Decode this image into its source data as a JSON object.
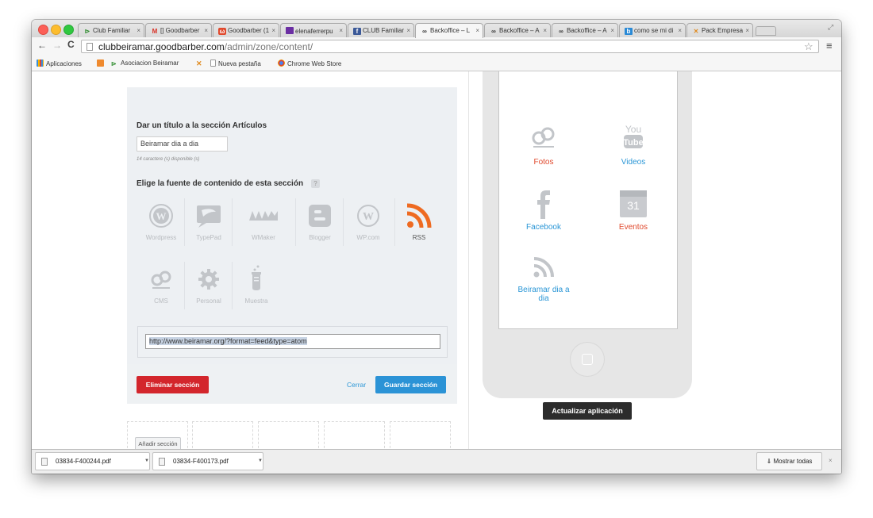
{
  "browser": {
    "tabs": [
      {
        "label": "Club Familiar",
        "icon": "club-icon"
      },
      {
        "label": "[] Goodbarber",
        "icon": "gmail-icon"
      },
      {
        "label": "Goodbarber (1",
        "icon": "goodbarber-icon"
      },
      {
        "label": "elenaferrerpu",
        "icon": "yahoo-mail-icon"
      },
      {
        "label": "CLUB Familiar",
        "icon": "facebook-icon"
      },
      {
        "label": "Backoffice – L",
        "icon": "goodbarber-logo-icon"
      },
      {
        "label": "Backoffice – A",
        "icon": "goodbarber-logo-icon"
      },
      {
        "label": "Backoffice – A",
        "icon": "goodbarber-logo-icon"
      },
      {
        "label": "como se mi di",
        "icon": "bing-icon"
      },
      {
        "label": "Pack Empresa",
        "icon": "pack-icon"
      }
    ],
    "tab_close_glyph": "×",
    "url_host": "clubbeiramar.goodbarber.com",
    "url_path": "/admin/zone/content/",
    "bookmarks": [
      {
        "label": "Aplicaciones",
        "icon": "apps-grid-icon"
      },
      {
        "label": "",
        "icon": "bookmark-icon"
      },
      {
        "label": "Asociacion Beiramar",
        "icon": "beiramar-icon"
      },
      {
        "label": "",
        "icon": "joomla-icon"
      },
      {
        "label": "Nueva pestaña",
        "icon": "page-icon"
      },
      {
        "label": "Chrome Web Store",
        "icon": "chrome-store-icon"
      }
    ]
  },
  "editor": {
    "title_label": "Dar un título a la sección Artículos",
    "title_value": "Beiramar dia a dia",
    "title_hint": "14 caractere (s) disponible (s)",
    "source_label": "Elige la fuente de contenido de esta sección",
    "help_glyph": "?",
    "sources": [
      {
        "label": "Wordpress",
        "icon": "wordpress-icon",
        "selected": false
      },
      {
        "label": "TypePad",
        "icon": "typepad-icon",
        "selected": false
      },
      {
        "label": "WMaker",
        "icon": "wmaker-icon",
        "selected": false
      },
      {
        "label": "Blogger",
        "icon": "blogger-icon",
        "selected": false
      },
      {
        "label": "WP.com",
        "icon": "wpcom-icon",
        "selected": false
      },
      {
        "label": "RSS",
        "icon": "rss-icon",
        "selected": true
      },
      {
        "label": "CMS",
        "icon": "cms-icon",
        "selected": false
      },
      {
        "label": "Personal",
        "icon": "gear-icon",
        "selected": false
      },
      {
        "label": "Muestra",
        "icon": "test-tube-icon",
        "selected": false
      }
    ],
    "feed_url": "http://www.beiramar.org/?format=feed&type=atom",
    "delete_label": "Eliminar sección",
    "close_label": "Cerrar",
    "save_label": "Guardar sección",
    "add_section_label": "Añadir sección"
  },
  "preview": {
    "apps": [
      {
        "label": "Fotos",
        "icon": "fotos-icon",
        "color": "#e0492d"
      },
      {
        "label": "Videos",
        "icon": "youtube-icon",
        "color": "#2a96d6"
      },
      {
        "label": "Facebook",
        "icon": "facebook-f-icon",
        "color": "#2a96d6"
      },
      {
        "label": "Eventos",
        "icon": "calendar-icon",
        "color": "#e0492d"
      },
      {
        "label": "Beiramar dia a dia",
        "icon": "rss-icon",
        "color": "#2a96d6"
      }
    ],
    "calendar_day": "31",
    "update_label": "Actualizar aplicación"
  },
  "downloads": {
    "items": [
      {
        "name": "03834-F400244.pdf"
      },
      {
        "name": "03834-F400173.pdf"
      }
    ],
    "show_all_label": "Mostrar todas",
    "close_glyph": "×"
  },
  "colors": {
    "accent": "#2b93d6",
    "danger": "#d3262c",
    "rss": "#ee6a21"
  }
}
